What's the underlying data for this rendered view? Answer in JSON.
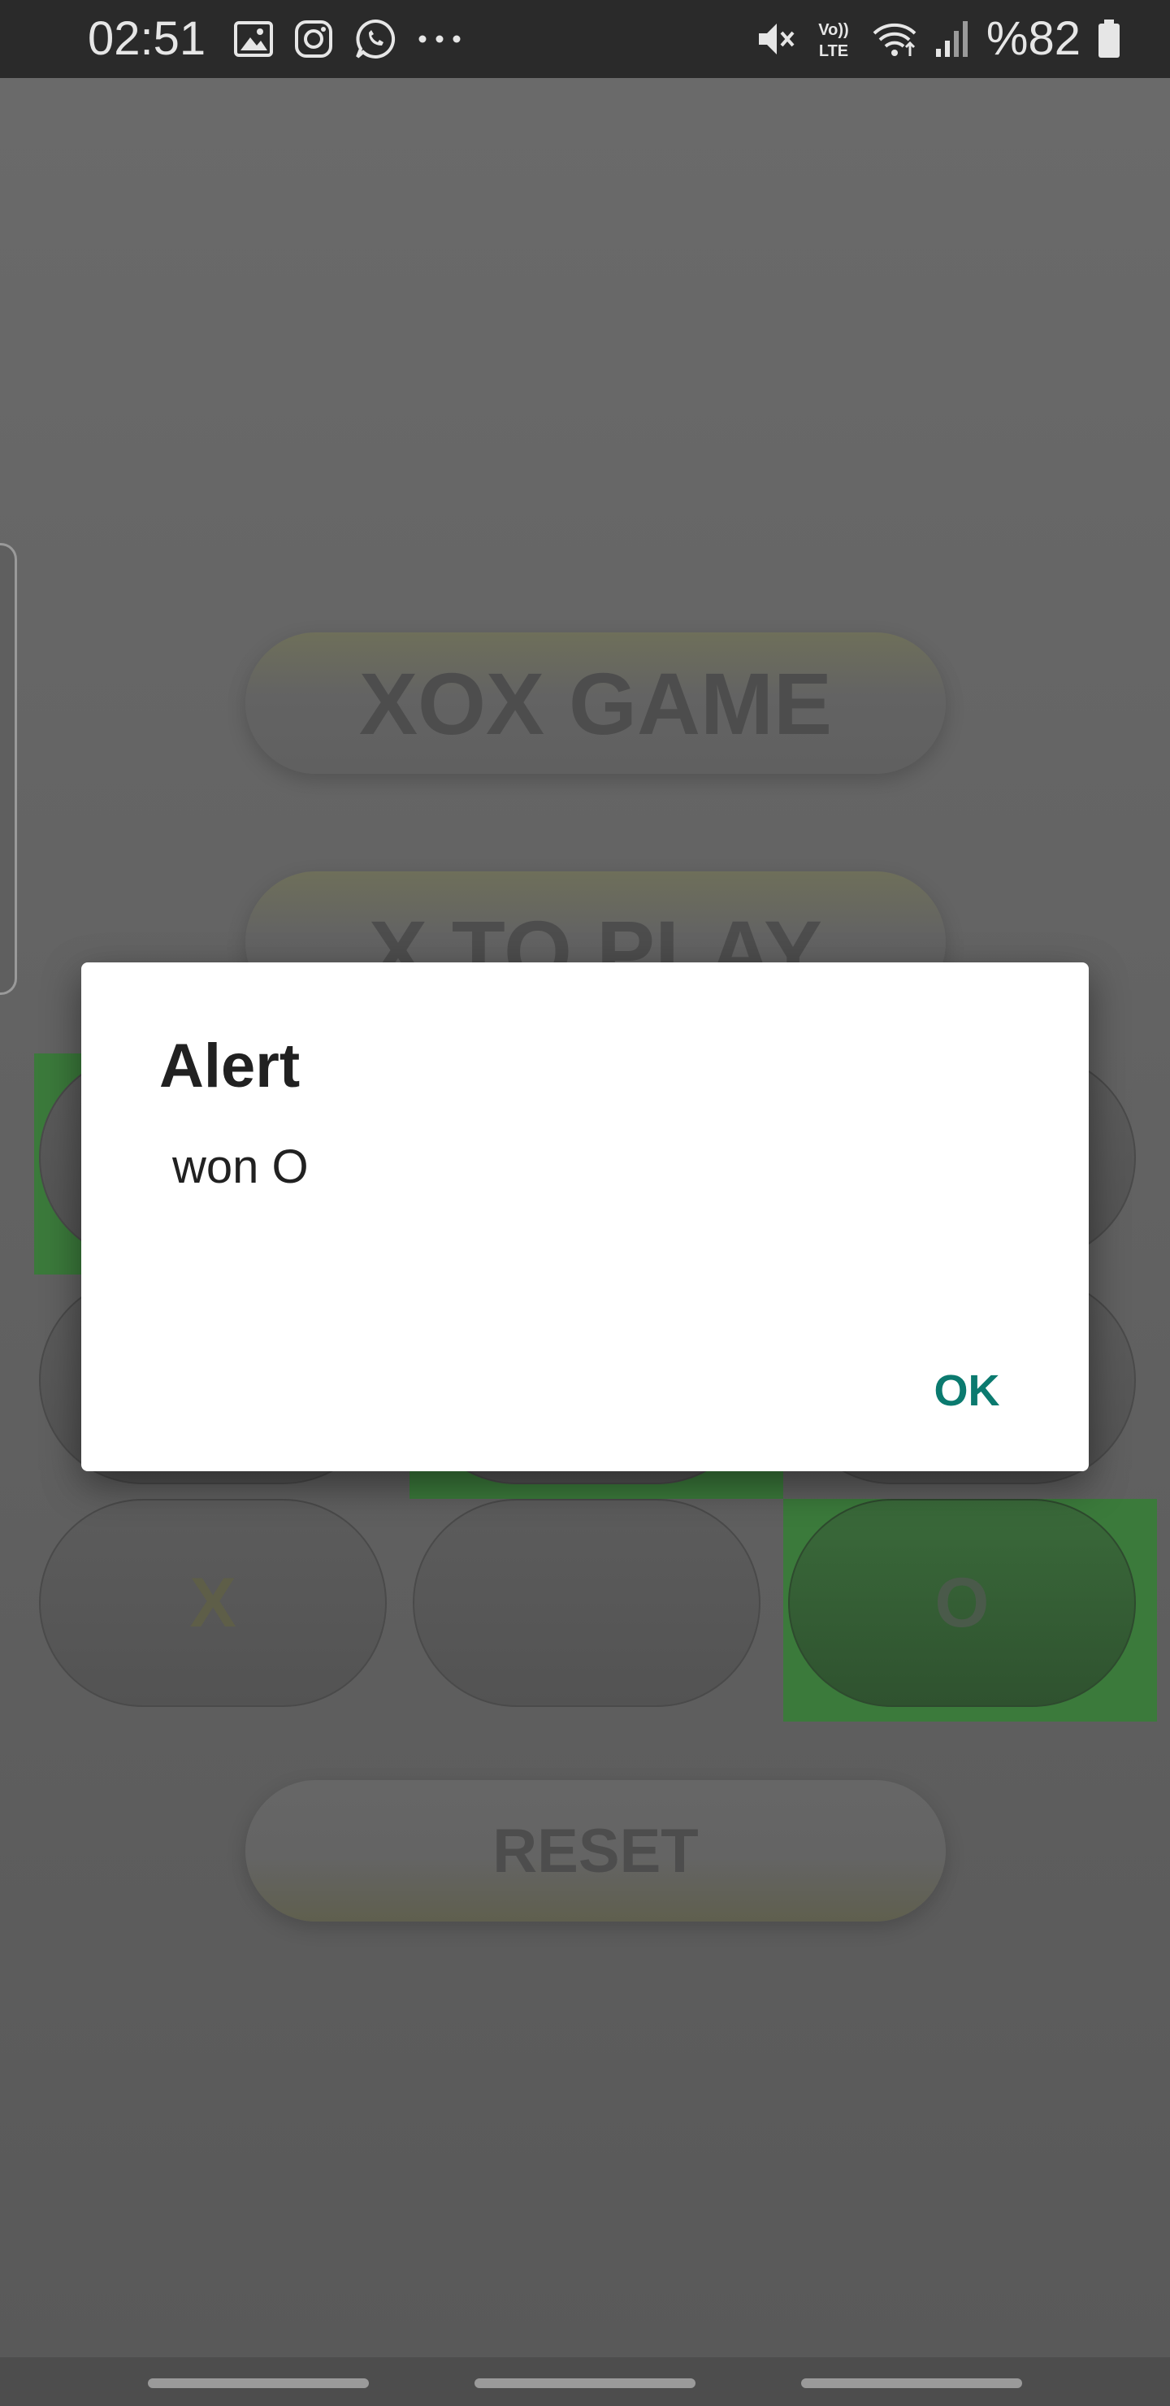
{
  "status_bar": {
    "time": "02:51",
    "battery": "%82",
    "left_icons": [
      "gallery-icon",
      "instagram-icon",
      "whatsapp-icon",
      "more-dots-icon"
    ],
    "right_icons": [
      "mute-icon",
      "volte-icon",
      "wifi-icon",
      "signal-icon",
      "battery-icon"
    ]
  },
  "app": {
    "title": "XOX GAME",
    "turn_label": "X TO PLAY",
    "reset_label": "RESET",
    "board": [
      [
        "",
        "",
        ""
      ],
      [
        "",
        "",
        ""
      ],
      [
        "X",
        "",
        "O"
      ]
    ],
    "colors": {
      "highlight": "#3b7a3b",
      "dialog_ok": "#0b7a6f"
    }
  },
  "dialog": {
    "title": "Alert",
    "message": "won O",
    "ok_label": "OK"
  }
}
